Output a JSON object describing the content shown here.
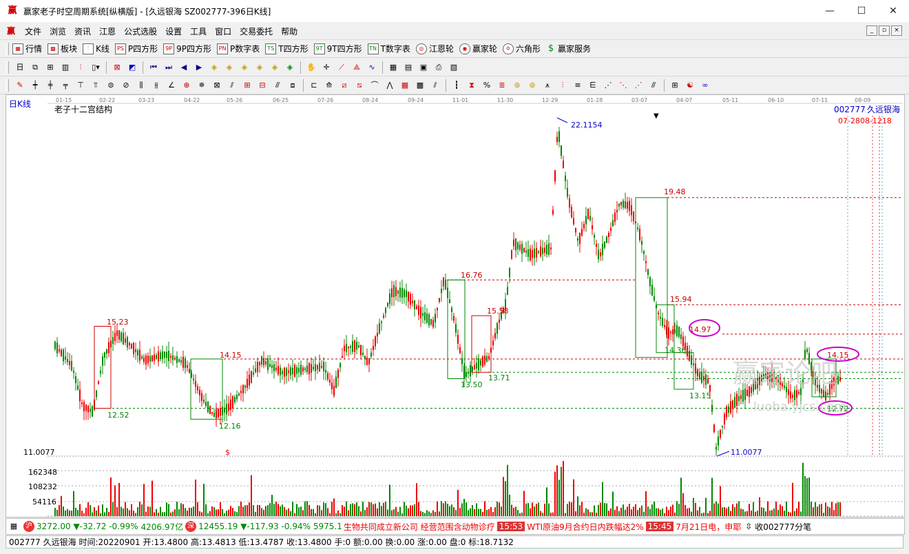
{
  "window": {
    "title": "赢家老子时空周期系统[纵横版] - [久远银海  SZ002777-396日K线]",
    "minimize": "—",
    "maximize": "☐",
    "close": "✕"
  },
  "menu": [
    "文件",
    "浏览",
    "资讯",
    "江恩",
    "公式选股",
    "设置",
    "工具",
    "窗口",
    "交易委托",
    "帮助"
  ],
  "toolbar1": [
    {
      "icon": "grid-icon",
      "label": "行情"
    },
    {
      "icon": "blocks-icon",
      "label": "板块"
    },
    {
      "icon": "candle-icon",
      "label": "K线"
    },
    {
      "icon": "ps-icon",
      "label": "P四方形"
    },
    {
      "icon": "9p-icon",
      "label": "9P四方形"
    },
    {
      "icon": "pn-icon",
      "label": "P数字表"
    },
    {
      "icon": "ts-icon",
      "label": "T四方形"
    },
    {
      "icon": "9t-icon",
      "label": "9T四方形"
    },
    {
      "icon": "tn-icon",
      "label": "T数字表"
    },
    {
      "icon": "wheel-icon",
      "label": "江恩轮"
    },
    {
      "icon": "wheel2-icon",
      "label": "赢家轮"
    },
    {
      "icon": "hexagon-icon",
      "label": "六角形"
    },
    {
      "icon": "dollar-icon",
      "label": "赢家服务"
    }
  ],
  "chart": {
    "period_label": "日K线",
    "indicator_title": "老子十二宫结构",
    "stock_code": "002777",
    "stock_name": "久远银海",
    "right_dates": "07-2808-1218",
    "x_dates": [
      "01-15",
      "02-22",
      "03-23",
      "04-22",
      "05-26",
      "06-25",
      "07-26",
      "08-24",
      "09-24",
      "11-01",
      "11-30",
      "12-29",
      "01-28",
      "03-07",
      "04-07",
      "05-11",
      "06-10",
      "07-11",
      "08-09"
    ],
    "price_labels": [
      {
        "text": "22.1154",
        "color": "#00c"
      },
      {
        "text": "19.48",
        "color": "#c00"
      },
      {
        "text": "16.76",
        "color": "#c00"
      },
      {
        "text": "15.94",
        "color": "#c00"
      },
      {
        "text": "15.58",
        "color": "#c00"
      },
      {
        "text": "15.23",
        "color": "#c00"
      },
      {
        "text": "14.97",
        "color": "#c00"
      },
      {
        "text": "14.15",
        "color": "#c00"
      },
      {
        "text": "14.15",
        "color": "#c00"
      },
      {
        "text": "14.36",
        "color": "#080"
      },
      {
        "text": "13.71",
        "color": "#080"
      },
      {
        "text": "13.50",
        "color": "#080"
      },
      {
        "text": "13.15",
        "color": "#080"
      },
      {
        "text": "12.72",
        "color": "#080"
      },
      {
        "text": "12.52",
        "color": "#080"
      },
      {
        "text": "12.16",
        "color": "#080"
      },
      {
        "text": "11.0077",
        "color": "#00c"
      }
    ],
    "y_left_label": "11.0077",
    "dollar_marker": "$",
    "volume_labels": [
      "162348",
      "108232",
      "54116"
    ],
    "watermark_main": "赢家论吧",
    "watermark_sub": "luoba.yjcs.com"
  },
  "ticker": {
    "idx1_value": "3272.00",
    "idx1_change": "▼-32.72",
    "idx1_pct": "-0.99%",
    "idx1_amount": "4206.97亿",
    "idx2_value": "12455.19",
    "idx2_change": "▼-117.93",
    "idx2_pct": "-0.94%",
    "idx2_amount": "5975.1",
    "news1": "生物共同成立新公司 经营范围含动物诊疗",
    "time2": "15:53",
    "news2": "WTI原油9月合约日内跌幅达2%",
    "time3": "15:45",
    "news3": "7月21日电，申耶",
    "right": "收002777分笔"
  },
  "status": {
    "code": "002777",
    "name": "久远银海",
    "time_label": "时间:",
    "time": "20220901",
    "open_label": "开:",
    "open": "13.4800",
    "high_label": "高:",
    "high": "13.4813",
    "low_label": "低:",
    "low": "13.4787",
    "close_label": "收:",
    "close": "13.4800",
    "hand_label": "手:",
    "hand": "0",
    "amount_label": "额:",
    "amount": "0.00",
    "turnover_label": "换:",
    "turnover": "0.00",
    "chg_label": "涨:",
    "chg": "0.00",
    "pan_label": "盘:",
    "pan": "0",
    "mark_label": "标:",
    "mark": "18.7132"
  }
}
